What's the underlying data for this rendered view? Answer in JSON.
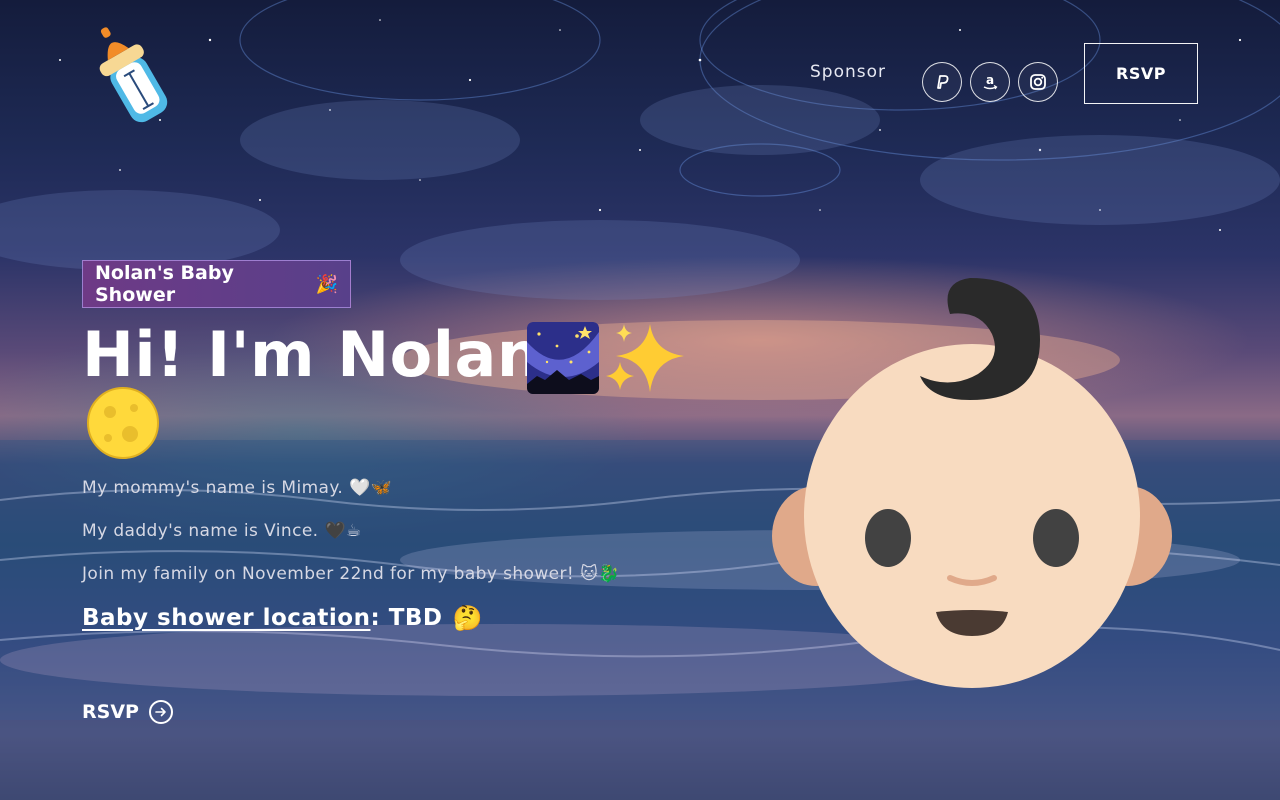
{
  "nav": {
    "sponsor_label": "Sponsor",
    "social_icons": [
      "paypal-icon",
      "amazon-icon",
      "instagram-icon"
    ],
    "rsvp_label": "RSVP"
  },
  "hero": {
    "badge_label": "Nolan's Baby Shower",
    "badge_emoji": "🎉",
    "headline": "Hi! I'm Nolan!",
    "headline_icons": [
      "night-sky-icon",
      "sparkles-icon",
      "moon-icon"
    ],
    "mommy_line": "My mommy's name is Mimay.",
    "mommy_emoji": "🤍🦋",
    "daddy_line": "My daddy's name is Vince.",
    "daddy_emoji": "🖤☕",
    "join_line": "Join my family on November 22nd for my baby shower!",
    "join_emoji": "🐱🐉",
    "location_link": "Baby shower location",
    "location_value": ": TBD",
    "location_emoji": "🤔",
    "rsvp_label": "RSVP"
  },
  "colors": {
    "badge_bg": "#6e3a86",
    "text": "#ffffff",
    "muted_text": "#d6d8e4"
  }
}
